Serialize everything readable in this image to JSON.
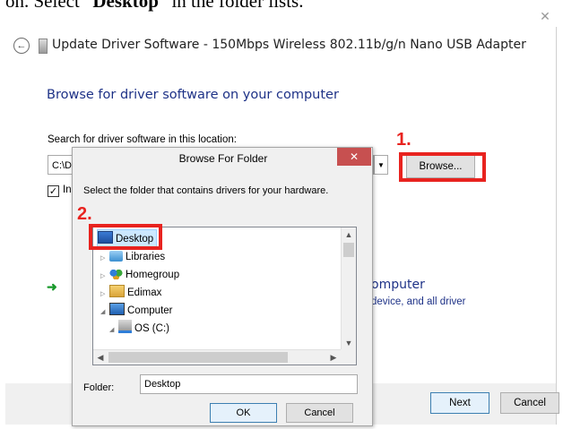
{
  "document_text": {
    "prefix": "on.  Select “",
    "bold": "Desktop",
    "suffix": "” in the folder lists."
  },
  "wizard": {
    "title": "Update Driver Software - 150Mbps Wireless 802.11b/g/n Nano USB Adapter",
    "heading": "Browse for driver software on your computer",
    "search_label": "Search for driver software in this location:",
    "path_value": "C:\\D",
    "browse_label": "Browse...",
    "include_label_visible": "In",
    "include_checked": true,
    "pick_title_visible": "omputer",
    "pick_desc_visible": "device, and all driver",
    "next_label": "Next",
    "cancel_label": "Cancel"
  },
  "dialog": {
    "title": "Browse For Folder",
    "instruction": "Select the folder that contains drivers for your hardware.",
    "tree": [
      {
        "label": "Desktop",
        "icon": "desktop-icon",
        "selected": true,
        "expander": ""
      },
      {
        "label": "Libraries",
        "icon": "libraries-icon",
        "selected": false,
        "expander": "collapsed"
      },
      {
        "label": "Homegroup",
        "icon": "homegroup-icon",
        "selected": false,
        "expander": "collapsed"
      },
      {
        "label": "Edimax",
        "icon": "user-folder-icon",
        "selected": false,
        "expander": "collapsed"
      },
      {
        "label": "Computer",
        "icon": "computer-icon",
        "selected": false,
        "expander": "expanded"
      },
      {
        "label": "OS (C:)",
        "icon": "drive-icon",
        "selected": false,
        "expander": "expanded"
      }
    ],
    "folder_label": "Folder:",
    "folder_value": "Desktop",
    "ok_label": "OK",
    "cancel_label": "Cancel"
  },
  "annotations": {
    "step1": "1.",
    "step2": "2.",
    "highlight_color": "#e8231f"
  },
  "colors": {
    "link_blue": "#1e3287",
    "selection_blue": "#cce8ff"
  }
}
